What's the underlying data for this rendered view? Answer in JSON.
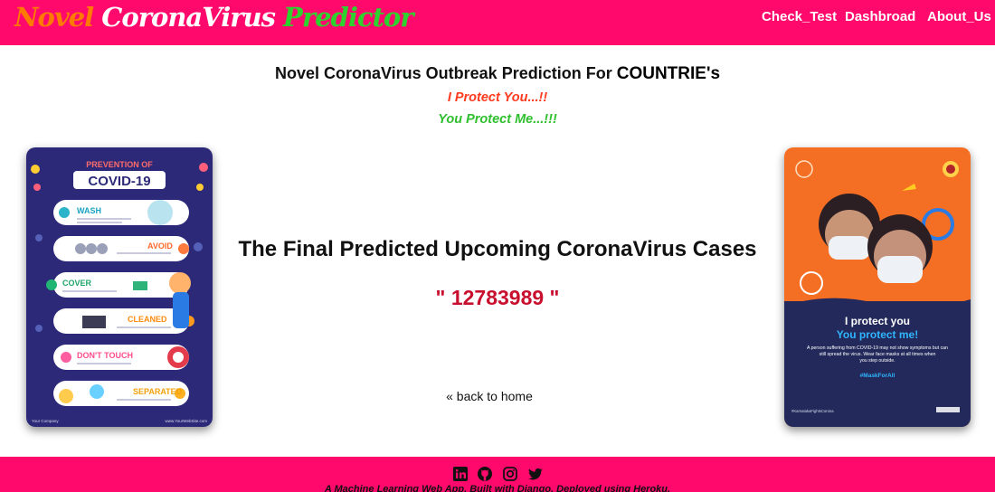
{
  "header": {
    "brand_word1": "Novel",
    "brand_word2": "CoronaVirus",
    "brand_word3": "Predictor",
    "nav": [
      "Check_Test",
      "Dashbroad",
      "About_Us"
    ]
  },
  "main": {
    "title_prefix": "Novel CoronaVirus Outbreak Prediction For",
    "title_strong": "COUNTRIE's",
    "tagline1": "I Protect You...!!",
    "tagline2": "You Protect Me...!!!",
    "result_title": "The Final Predicted Upcoming CoronaVirus Cases",
    "result_value": "\" 12783989 \"",
    "back_link": "« back to home"
  },
  "left_poster": {
    "heading1": "PREVENTION OF",
    "heading2": "COVID-19",
    "items": [
      "WASH",
      "AVOID",
      "COVER",
      "CLEANED",
      "DON'T TOUCH",
      "SEPARATED"
    ],
    "footer_left": "Your Company",
    "footer_right": "www.YourWebSite.com"
  },
  "right_poster": {
    "line1": "I protect you",
    "line2": "You protect me!",
    "body": [
      "A person suffering from COVID-19 may not show symptoms but can",
      "still spread the virus. Wear face masks at all times when",
      "you step outside."
    ],
    "hashtag": "#MaskForAll",
    "footer_left": "#KarnatakaFightsCorona"
  },
  "footer": {
    "icons": [
      "linkedin-icon",
      "github-icon",
      "instagram-icon",
      "twitter-icon"
    ],
    "text": "A Machine Learning Web App, Built with Django, Deployed using Heroku."
  },
  "colors": {
    "accent": "#ff0a6c",
    "brand_orange": "#ff7a00",
    "brand_green": "#2fd12f",
    "result_red": "#c8102e"
  }
}
